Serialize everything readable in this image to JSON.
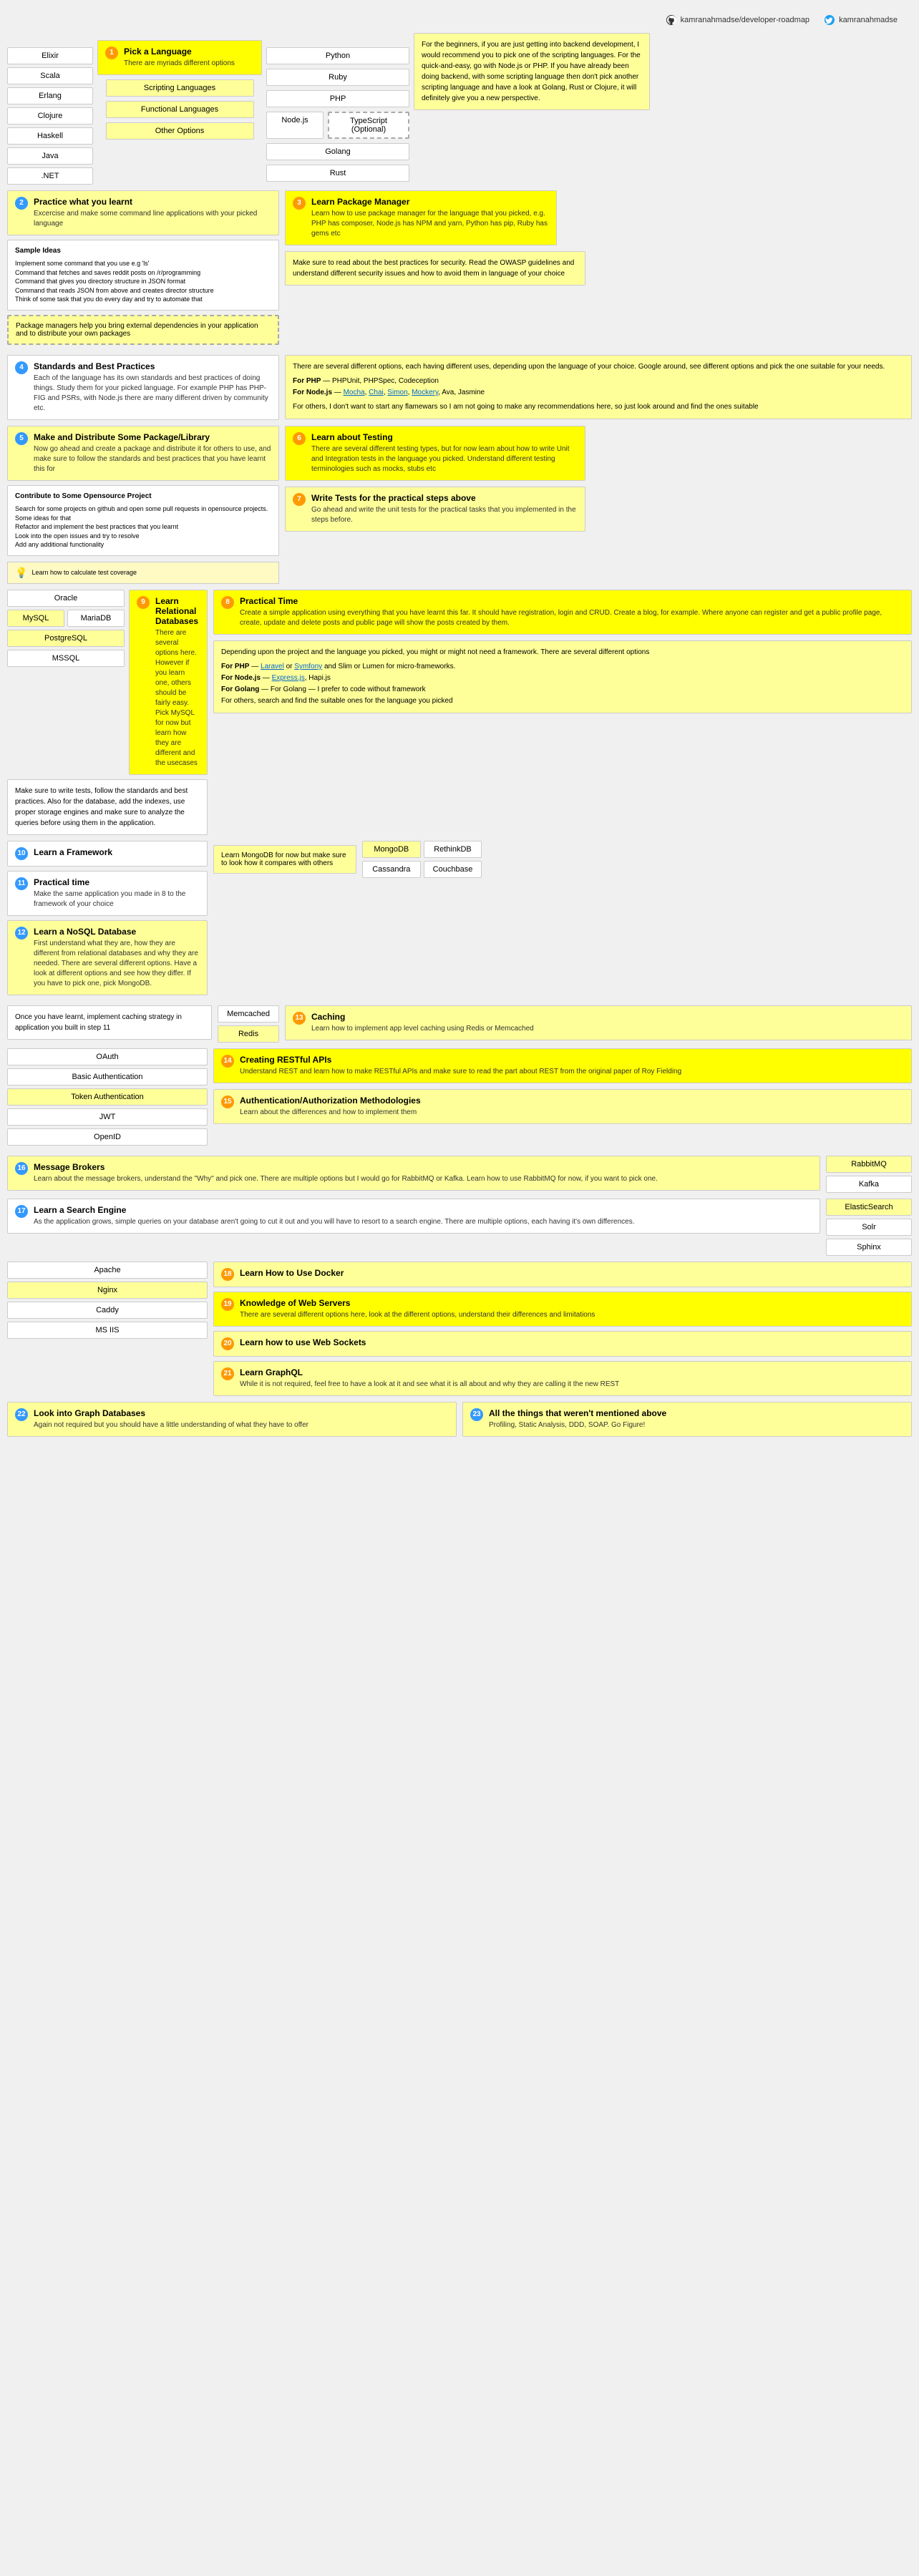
{
  "header": {
    "github_link": "kamranahmadse/developer-roadmap",
    "twitter_link": "kamranahmadse"
  },
  "section1": {
    "num": "1",
    "title": "Pick a Language",
    "desc": "There are myriads different options",
    "left_items": [
      "Elixir",
      "Scala",
      "Erlang",
      "Clojure",
      "Haskell",
      "Java",
      ".NET"
    ],
    "categories": [
      "Scripting Languages",
      "Functional Languages",
      "Other Options"
    ],
    "right_items": {
      "normal": [
        "Python",
        "Ruby",
        "PHP",
        "Node.js",
        "Golang",
        "Rust"
      ],
      "optional": "TypeScript (Optional)"
    }
  },
  "intro_text": {
    "content": "For the beginners, if you are just getting into backend development, I would recommend you to pick one of the scripting languages. For the quick-and-easy, go with Node.js or PHP. If you have already been doing backend, with some scripting language then don't pick another scripting language and have a look at Golang, Rust or Clojure, it will definitely give you a new perspective."
  },
  "section2": {
    "num": "2",
    "title": "Practice what you learnt",
    "desc": "Excercise and make some command line applications with your picked language"
  },
  "sample_ideas": {
    "title": "Sample Ideas",
    "items": [
      "Implement some command that you use e.g 'ls'",
      "Command that fetches and saves reddit posts on /r/programming",
      "Command that gives you directory structure in JSON format",
      "Command that reads JSON from above and creates director structure",
      "Think of some task that you do every day and try to automate that"
    ]
  },
  "package_manager_note": "Package managers help you bring external dependencies in your application and to distribute your own packages",
  "section3": {
    "num": "3",
    "title": "Learn Package Manager",
    "desc": "Learn how to use package manager for the language that you picked, e.g. PHP has composer, Node.js has NPM and yarn, Python has pip, Ruby has gems etc"
  },
  "security_note": "Make sure to read about the best practices for security. Read the OWASP guidelines and understand different security issues and how to avoid them in language of your choice",
  "section4": {
    "num": "4",
    "title": "Standards and Best Practices",
    "desc": "Each of the language has its own standards and best practices of doing things. Study them for your picked language. For example PHP has PHP-FIG and PSRs, with Node.js there are many different driven by community etc."
  },
  "frameworks_note": {
    "content": "There are several different options, each having different uses, depending upon the language of your choice. Google around, see different options and pick the one suitable for your needs.",
    "php": "For PHP — PHPUnit, PHPSpec, Codeception",
    "nodejs": "For Node.js — Mocha, Chai, Simon, Mockery, Ava, Jasmine",
    "others": "For others, I don't want to start any flamewars so I am not going to make any recommendations here, so just look around and find the ones suitable"
  },
  "section5": {
    "num": "5",
    "title": "Make and Distribute Some Package/Library",
    "desc": "Now go ahead and create a package and distribute it for others to use, and make sure to follow the standards and best practices that you have learnt this for"
  },
  "opensource": {
    "title": "Contribute to Some Opensource Project",
    "items": [
      "Search for some projects on github and open some pull requests in opensource projects. Some ideas for that",
      "Refactor and implement the best practices that you learnt",
      "Look into the open issues and try to resolve",
      "Add any additional functionality"
    ]
  },
  "test_coverage": "Learn how to calculate test coverage",
  "section6": {
    "num": "6",
    "title": "Learn about Testing",
    "desc": "There are several different testing types, but for now learn about how to write Unit and Integration tests in the language you picked. Understand different testing terminologies such as mocks, stubs etc"
  },
  "section7": {
    "num": "7",
    "title": "Write Tests for the practical steps above",
    "desc": "Go ahead and write the unit tests for the practical tasks that you implemented in the steps before."
  },
  "section8": {
    "num": "8",
    "title": "Practical Time",
    "desc": "Create a simple application using everything that you have learnt this far. It should have registration, login and CRUD. Create a blog, for example. Where anyone can register and get a public profile page, create, update and delete posts and public page will show the posts created by them."
  },
  "databases": {
    "relational_section": {
      "num": "9",
      "title": "Learn Relational Databases",
      "desc": "There are several options here. However if you learn one, others should be fairly easy. Pick MySQL for now but learn how they are different and the usecases"
    },
    "items": [
      "Oracle",
      "MySQL",
      "MariaDB",
      "PostgreSQL",
      "MSSQL"
    ]
  },
  "db_note": "Make sure to write tests, follow the standards and best practices. Also for the database, add the indexes, use proper storage engines and make sure to analyze the queries before using them in the application.",
  "section10": {
    "num": "10",
    "title": "Learn a Framework",
    "desc_prefix": "",
    "content": "Depending upon the project and the language you picked, you might or might not need a framework. There are several different options",
    "php": "For PHP — Laravel or Symfony and Slim or Lumen for micro-frameworks.",
    "nodejs": "For Node.js — Express.js, Hapi.js",
    "golang": "For Golang — I prefer to code without framework",
    "others": "For others, search and find the suitable ones for the language you picked"
  },
  "section11": {
    "num": "11",
    "title": "Practical time",
    "desc": "Make the same application you made in 8 to the framework of your choice"
  },
  "section12": {
    "num": "12",
    "title": "Learn a NoSQL Database",
    "desc": "First understand what they are, how they are different from relational databases and why they are needed. There are several different options. Have a look at different options and see how they differ. If you have to pick one, pick MongoDB."
  },
  "nosql_items": {
    "learn_note": "Learn MongoDB for now but make sure to look how it compares with others",
    "items": [
      "MongoDB",
      "RethinkDB",
      "Cassandra",
      "Couchbase"
    ]
  },
  "section13": {
    "num": "13",
    "title": "Caching",
    "desc": "Once you have learnt, implement caching strategy in application you built in step 11",
    "note": "Learn how to implement app level caching using Redis or Memcached",
    "items": [
      "Memcached",
      "Redis"
    ]
  },
  "section14": {
    "num": "14",
    "title": "Creating RESTful APIs",
    "desc": "Understand REST and learn how to make RESTful APIs and make sure to read the part about REST from the original paper of Roy Fielding"
  },
  "section15": {
    "num": "15",
    "title": "Authentication/Authorization Methodologies",
    "desc": "Learn about the differences and how to implement them",
    "items": [
      "OAuth",
      "Basic Authentication",
      "Token Authentication",
      "JWT",
      "OpenID"
    ]
  },
  "section16": {
    "num": "16",
    "title": "Message Brokers",
    "desc": "Learn about the message brokers, understand the \"Why\" and pick one. There are multiple options but I would go for RabbitMQ or Kafka. Learn how to use RabbitMQ for now, if you want to pick one.",
    "items": [
      "RabbitMQ",
      "Kafka"
    ]
  },
  "section17": {
    "num": "17",
    "title": "Learn a Search Engine",
    "desc": "As the application grows, simple queries on your database aren't going to cut it out and you will have to resort to a search engine. There are multiple options, each having it's own differences.",
    "items": [
      "ElasticSearch",
      "Solr",
      "Sphinx"
    ]
  },
  "section18": {
    "num": "18",
    "title": "Learn How to Use Docker"
  },
  "section19": {
    "num": "19",
    "title": "Knowledge of Web Servers",
    "desc": "There are several different options here, look at the different options, understand their differences and limitations",
    "items": [
      "Apache",
      "Nginx",
      "Caddy",
      "MS IIS"
    ]
  },
  "section20": {
    "num": "20",
    "title": "Learn how to use Web Sockets"
  },
  "section21": {
    "num": "21",
    "title": "Learn GraphQL",
    "desc": "While it is not required, feel free to have a look at it and see what it is all about and why they are calling it the new REST"
  },
  "section22": {
    "num": "22",
    "title": "Look into Graph Databases",
    "desc": "Again not required but you should have a little understanding of what they have to offer"
  },
  "section23": {
    "num": "23",
    "title": "All the things that weren't mentioned above",
    "desc": "Profiling, Static Analysis, DDD, SOAP. Go Figure!"
  }
}
